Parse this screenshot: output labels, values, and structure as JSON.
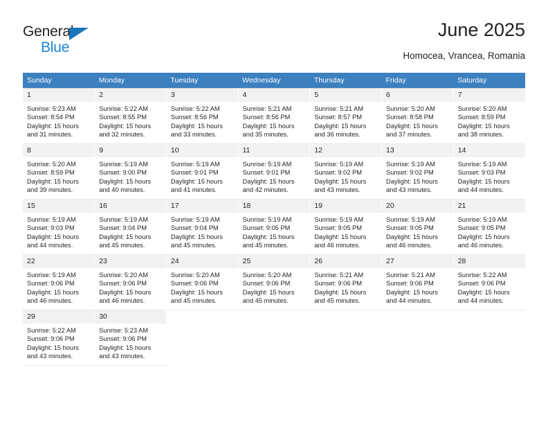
{
  "logo": {
    "word_top": "General",
    "word_bottom": "Blue",
    "triangle_color": "#1b75bb",
    "blue_text_color": "#1b84d6"
  },
  "header": {
    "title": "June 2025",
    "subtitle": "Homocea, Vrancea, Romania"
  },
  "theme": {
    "header_row_bg": "#3c80c0",
    "header_row_text": "#ffffff",
    "daynum_bg": "#f2f2f2",
    "body_text": "#231f20"
  },
  "weekday_headers": [
    "Sunday",
    "Monday",
    "Tuesday",
    "Wednesday",
    "Thursday",
    "Friday",
    "Saturday"
  ],
  "weeks": [
    [
      {
        "day": "1",
        "sunrise": "Sunrise: 5:23 AM",
        "sunset": "Sunset: 8:54 PM",
        "daylight_1": "Daylight: 15 hours",
        "daylight_2": "and 31 minutes."
      },
      {
        "day": "2",
        "sunrise": "Sunrise: 5:22 AM",
        "sunset": "Sunset: 8:55 PM",
        "daylight_1": "Daylight: 15 hours",
        "daylight_2": "and 32 minutes."
      },
      {
        "day": "3",
        "sunrise": "Sunrise: 5:22 AM",
        "sunset": "Sunset: 8:56 PM",
        "daylight_1": "Daylight: 15 hours",
        "daylight_2": "and 33 minutes."
      },
      {
        "day": "4",
        "sunrise": "Sunrise: 5:21 AM",
        "sunset": "Sunset: 8:56 PM",
        "daylight_1": "Daylight: 15 hours",
        "daylight_2": "and 35 minutes."
      },
      {
        "day": "5",
        "sunrise": "Sunrise: 5:21 AM",
        "sunset": "Sunset: 8:57 PM",
        "daylight_1": "Daylight: 15 hours",
        "daylight_2": "and 36 minutes."
      },
      {
        "day": "6",
        "sunrise": "Sunrise: 5:20 AM",
        "sunset": "Sunset: 8:58 PM",
        "daylight_1": "Daylight: 15 hours",
        "daylight_2": "and 37 minutes."
      },
      {
        "day": "7",
        "sunrise": "Sunrise: 5:20 AM",
        "sunset": "Sunset: 8:59 PM",
        "daylight_1": "Daylight: 15 hours",
        "daylight_2": "and 38 minutes."
      }
    ],
    [
      {
        "day": "8",
        "sunrise": "Sunrise: 5:20 AM",
        "sunset": "Sunset: 8:59 PM",
        "daylight_1": "Daylight: 15 hours",
        "daylight_2": "and 39 minutes."
      },
      {
        "day": "9",
        "sunrise": "Sunrise: 5:19 AM",
        "sunset": "Sunset: 9:00 PM",
        "daylight_1": "Daylight: 15 hours",
        "daylight_2": "and 40 minutes."
      },
      {
        "day": "10",
        "sunrise": "Sunrise: 5:19 AM",
        "sunset": "Sunset: 9:01 PM",
        "daylight_1": "Daylight: 15 hours",
        "daylight_2": "and 41 minutes."
      },
      {
        "day": "11",
        "sunrise": "Sunrise: 5:19 AM",
        "sunset": "Sunset: 9:01 PM",
        "daylight_1": "Daylight: 15 hours",
        "daylight_2": "and 42 minutes."
      },
      {
        "day": "12",
        "sunrise": "Sunrise: 5:19 AM",
        "sunset": "Sunset: 9:02 PM",
        "daylight_1": "Daylight: 15 hours",
        "daylight_2": "and 43 minutes."
      },
      {
        "day": "13",
        "sunrise": "Sunrise: 5:19 AM",
        "sunset": "Sunset: 9:02 PM",
        "daylight_1": "Daylight: 15 hours",
        "daylight_2": "and 43 minutes."
      },
      {
        "day": "14",
        "sunrise": "Sunrise: 5:19 AM",
        "sunset": "Sunset: 9:03 PM",
        "daylight_1": "Daylight: 15 hours",
        "daylight_2": "and 44 minutes."
      }
    ],
    [
      {
        "day": "15",
        "sunrise": "Sunrise: 5:19 AM",
        "sunset": "Sunset: 9:03 PM",
        "daylight_1": "Daylight: 15 hours",
        "daylight_2": "and 44 minutes."
      },
      {
        "day": "16",
        "sunrise": "Sunrise: 5:19 AM",
        "sunset": "Sunset: 9:04 PM",
        "daylight_1": "Daylight: 15 hours",
        "daylight_2": "and 45 minutes."
      },
      {
        "day": "17",
        "sunrise": "Sunrise: 5:19 AM",
        "sunset": "Sunset: 9:04 PM",
        "daylight_1": "Daylight: 15 hours",
        "daylight_2": "and 45 minutes."
      },
      {
        "day": "18",
        "sunrise": "Sunrise: 5:19 AM",
        "sunset": "Sunset: 9:05 PM",
        "daylight_1": "Daylight: 15 hours",
        "daylight_2": "and 45 minutes."
      },
      {
        "day": "19",
        "sunrise": "Sunrise: 5:19 AM",
        "sunset": "Sunset: 9:05 PM",
        "daylight_1": "Daylight: 15 hours",
        "daylight_2": "and 46 minutes."
      },
      {
        "day": "20",
        "sunrise": "Sunrise: 5:19 AM",
        "sunset": "Sunset: 9:05 PM",
        "daylight_1": "Daylight: 15 hours",
        "daylight_2": "and 46 minutes."
      },
      {
        "day": "21",
        "sunrise": "Sunrise: 5:19 AM",
        "sunset": "Sunset: 9:05 PM",
        "daylight_1": "Daylight: 15 hours",
        "daylight_2": "and 46 minutes."
      }
    ],
    [
      {
        "day": "22",
        "sunrise": "Sunrise: 5:19 AM",
        "sunset": "Sunset: 9:06 PM",
        "daylight_1": "Daylight: 15 hours",
        "daylight_2": "and 46 minutes."
      },
      {
        "day": "23",
        "sunrise": "Sunrise: 5:20 AM",
        "sunset": "Sunset: 9:06 PM",
        "daylight_1": "Daylight: 15 hours",
        "daylight_2": "and 46 minutes."
      },
      {
        "day": "24",
        "sunrise": "Sunrise: 5:20 AM",
        "sunset": "Sunset: 9:06 PM",
        "daylight_1": "Daylight: 15 hours",
        "daylight_2": "and 45 minutes."
      },
      {
        "day": "25",
        "sunrise": "Sunrise: 5:20 AM",
        "sunset": "Sunset: 9:06 PM",
        "daylight_1": "Daylight: 15 hours",
        "daylight_2": "and 45 minutes."
      },
      {
        "day": "26",
        "sunrise": "Sunrise: 5:21 AM",
        "sunset": "Sunset: 9:06 PM",
        "daylight_1": "Daylight: 15 hours",
        "daylight_2": "and 45 minutes."
      },
      {
        "day": "27",
        "sunrise": "Sunrise: 5:21 AM",
        "sunset": "Sunset: 9:06 PM",
        "daylight_1": "Daylight: 15 hours",
        "daylight_2": "and 44 minutes."
      },
      {
        "day": "28",
        "sunrise": "Sunrise: 5:22 AM",
        "sunset": "Sunset: 9:06 PM",
        "daylight_1": "Daylight: 15 hours",
        "daylight_2": "and 44 minutes."
      }
    ],
    [
      {
        "day": "29",
        "sunrise": "Sunrise: 5:22 AM",
        "sunset": "Sunset: 9:06 PM",
        "daylight_1": "Daylight: 15 hours",
        "daylight_2": "and 43 minutes."
      },
      {
        "day": "30",
        "sunrise": "Sunrise: 5:23 AM",
        "sunset": "Sunset: 9:06 PM",
        "daylight_1": "Daylight: 15 hours",
        "daylight_2": "and 43 minutes."
      },
      {
        "day": "",
        "sunrise": "",
        "sunset": "",
        "daylight_1": "",
        "daylight_2": ""
      },
      {
        "day": "",
        "sunrise": "",
        "sunset": "",
        "daylight_1": "",
        "daylight_2": ""
      },
      {
        "day": "",
        "sunrise": "",
        "sunset": "",
        "daylight_1": "",
        "daylight_2": ""
      },
      {
        "day": "",
        "sunrise": "",
        "sunset": "",
        "daylight_1": "",
        "daylight_2": ""
      },
      {
        "day": "",
        "sunrise": "",
        "sunset": "",
        "daylight_1": "",
        "daylight_2": ""
      }
    ]
  ]
}
